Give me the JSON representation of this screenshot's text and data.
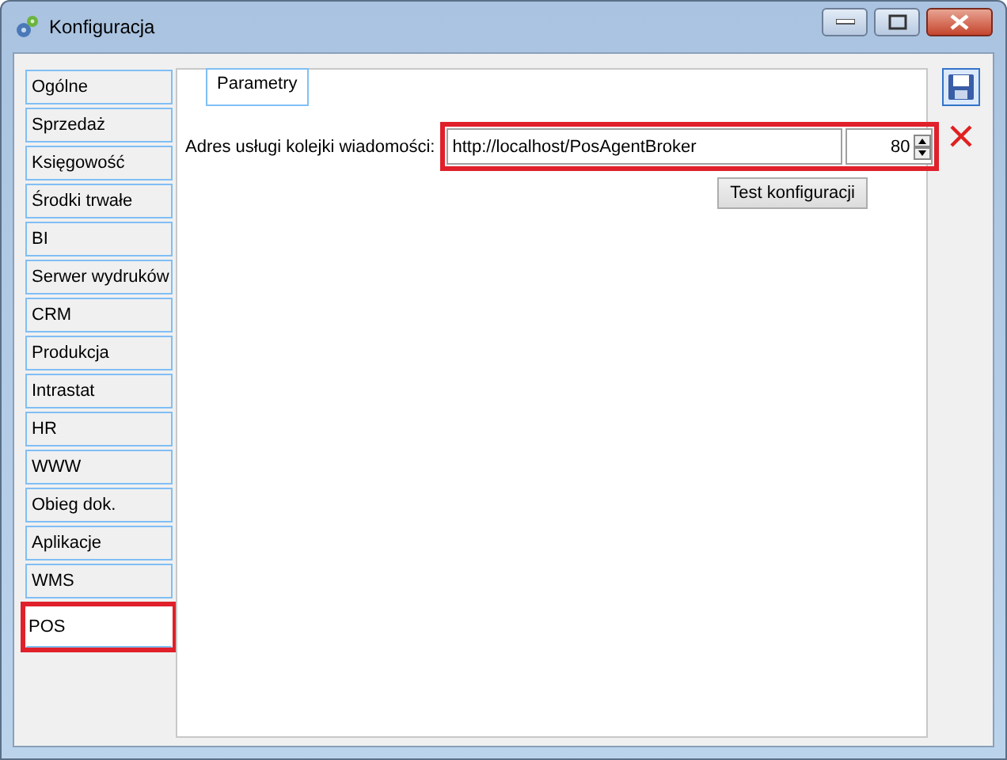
{
  "window": {
    "title": "Konfiguracja"
  },
  "sidebar": {
    "items": [
      {
        "label": "Ogólne",
        "selected": false
      },
      {
        "label": "Sprzedaż",
        "selected": false
      },
      {
        "label": "Księgowość",
        "selected": false
      },
      {
        "label": "Środki trwałe",
        "selected": false
      },
      {
        "label": "BI",
        "selected": false
      },
      {
        "label": "Serwer wydruków",
        "selected": false
      },
      {
        "label": "CRM",
        "selected": false
      },
      {
        "label": "Produkcja",
        "selected": false
      },
      {
        "label": "Intrastat",
        "selected": false
      },
      {
        "label": "HR",
        "selected": false
      },
      {
        "label": "WWW",
        "selected": false
      },
      {
        "label": "Obieg dok.",
        "selected": false
      },
      {
        "label": "Aplikacje",
        "selected": false
      },
      {
        "label": "WMS",
        "selected": false
      },
      {
        "label": "POS",
        "selected": true
      }
    ]
  },
  "tabs": [
    {
      "label": "Parametry",
      "selected": true
    }
  ],
  "form": {
    "label": "Adres usługi kolejki wiadomości:",
    "address": "http://localhost/PosAgentBroker",
    "port": "80",
    "test_button": "Test konfiguracji"
  }
}
